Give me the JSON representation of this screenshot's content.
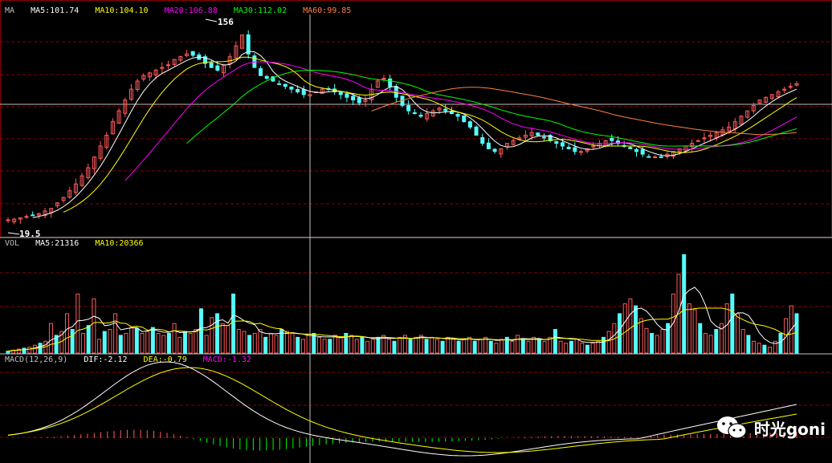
{
  "colors": {
    "background": "#000000",
    "grid": "#8b0000",
    "up": "#ff5a5a",
    "down": "#54fcfc",
    "ma5": "#ffffff",
    "ma10": "#ffff00",
    "ma20": "#ff00ff",
    "ma30": "#00ff00",
    "ma60": "#ff8040",
    "text": "#c0c0c0"
  },
  "price_panel": {
    "label": "MA",
    "ma5": "MA5:101.74",
    "ma10": "MA10:104.10",
    "ma20": "MA20:106.88",
    "ma30": "MA30:112.02",
    "ma60": "MA60:99.85",
    "peak_label": "156",
    "trough_label": "19.5"
  },
  "volume_panel": {
    "label": "VOL",
    "ma5": "MA5:21316",
    "ma10": "MA10:20366"
  },
  "macd_panel": {
    "label": "MACD(12,26,9)",
    "dif": "DIF:-2.12",
    "dea": "DEA:-0.79",
    "macd": "MACD:-1.32"
  },
  "watermark": {
    "text": "时光goni",
    "icon": "wechat-icon"
  },
  "chart_data": [
    {
      "type": "candlestick",
      "title": "",
      "ylim": [
        10,
        170
      ],
      "close_trend": [
        19.5,
        20,
        21,
        22,
        23,
        24,
        26,
        28,
        32,
        36,
        41,
        46,
        52,
        58,
        66,
        74,
        82,
        92,
        100,
        108,
        116,
        122,
        126,
        128,
        130,
        132,
        134,
        138,
        140,
        142,
        141,
        138,
        135,
        132,
        130,
        134,
        140,
        148,
        156,
        142,
        132,
        126,
        124,
        122,
        120,
        118,
        116,
        114,
        112,
        112,
        114,
        116,
        116,
        114,
        112,
        110,
        108,
        106,
        108,
        116,
        122,
        124,
        118,
        110,
        104,
        100,
        98,
        96,
        98,
        100,
        102,
        100,
        98,
        96,
        92,
        88,
        82,
        76,
        72,
        70,
        72,
        76,
        78,
        80,
        82,
        84,
        82,
        80,
        78,
        76,
        74,
        72,
        70,
        70,
        72,
        74,
        76,
        78,
        78,
        76,
        74,
        72,
        70,
        68,
        66,
        66,
        66,
        68,
        70,
        72,
        74,
        76,
        78,
        80,
        82,
        84,
        86,
        88,
        92,
        96,
        100,
        104,
        108,
        110,
        112,
        114,
        116,
        118,
        120
      ]
    },
    {
      "type": "bar",
      "title": "",
      "values_k": [
        2,
        3,
        4,
        5,
        6,
        8,
        10,
        12,
        30,
        18,
        22,
        40,
        24,
        60,
        20,
        28,
        55,
        14,
        22,
        24,
        40,
        18,
        20,
        26,
        25,
        20,
        22,
        26,
        20,
        18,
        20,
        30,
        16,
        22,
        20,
        24,
        45,
        18,
        36,
        40,
        30,
        28,
        60,
        24,
        22,
        18,
        20,
        24,
        16,
        20,
        18,
        24,
        22,
        20,
        16,
        14,
        18,
        20,
        16,
        14,
        14,
        18,
        16,
        20,
        18,
        14,
        16,
        12,
        14,
        16,
        18,
        14,
        12,
        16,
        18,
        14,
        16,
        18,
        14,
        16,
        14,
        12,
        16,
        14,
        12,
        14,
        16,
        12,
        14,
        16,
        12,
        10,
        14,
        16,
        12,
        18,
        14,
        12,
        16,
        14,
        12,
        16,
        24,
        12,
        10,
        12,
        14,
        10,
        8,
        10,
        12,
        16,
        22,
        30,
        40,
        50,
        55,
        48,
        35,
        25,
        20,
        18,
        24,
        30,
        60,
        80,
        100,
        50,
        44,
        30,
        20,
        18,
        24,
        30,
        50,
        60,
        40,
        24,
        18,
        12,
        10,
        8,
        6,
        12,
        20,
        35,
        48,
        40
      ]
    },
    {
      "type": "line",
      "title": "",
      "ylim": [
        -6,
        10
      ],
      "series_note": "DIF / DEA / MACD histogram"
    }
  ]
}
